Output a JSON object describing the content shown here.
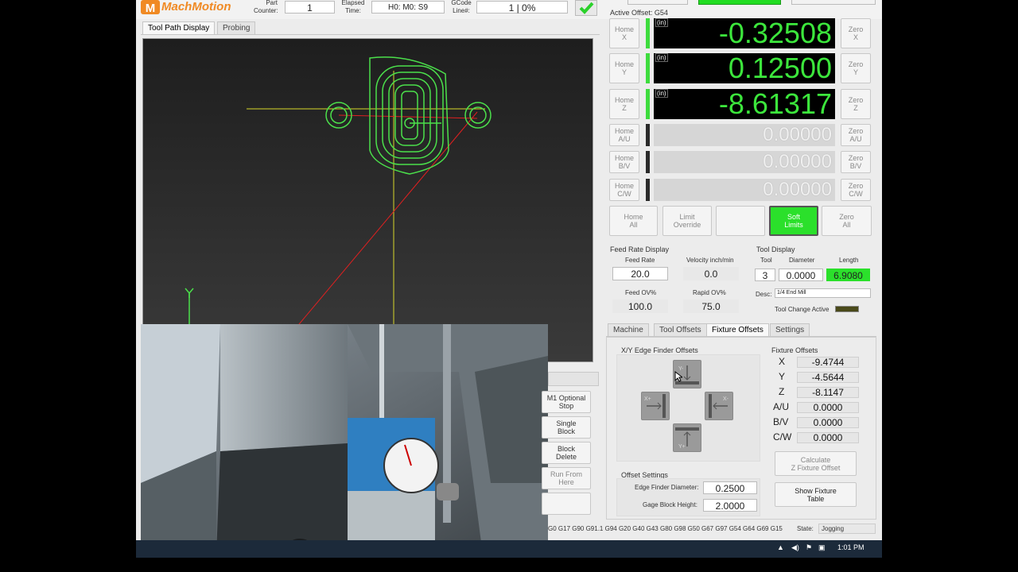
{
  "header": {
    "logo": "MachMotion",
    "part_counter_label": "Part\nCounter:",
    "part_counter": "1",
    "elapsed_label": "Elapsed\nTime:",
    "elapsed": "H0: M0: S9",
    "gcode_label": "GCode\nLine#:",
    "gcode_line": "1 | 0%"
  },
  "tabs_left": [
    {
      "label": "Tool Path Display"
    },
    {
      "label": "Probing"
    }
  ],
  "active_offset": "Active Offset: G54",
  "axes": [
    {
      "home": "Home\nX",
      "zero": "Zero\nX",
      "value": "-0.32508",
      "unit": "(in)",
      "active": true
    },
    {
      "home": "Home\nY",
      "zero": "Zero\nY",
      "value": "0.12500",
      "unit": "(in)",
      "active": true
    },
    {
      "home": "Home\nZ",
      "zero": "Zero\nZ",
      "value": "-8.61317",
      "unit": "(in)",
      "active": true
    },
    {
      "home": "Home\nA/U",
      "zero": "Zero\nA/U",
      "value": "0.00000",
      "unit": "",
      "active": false
    },
    {
      "home": "Home\nB/V",
      "zero": "Zero\nB/V",
      "value": "0.00000",
      "unit": "",
      "active": false
    },
    {
      "home": "Home\nC/W",
      "zero": "Zero\nC/W",
      "value": "0.00000",
      "unit": "",
      "active": false
    }
  ],
  "bottom_buttons": [
    {
      "label": "Home\nAll"
    },
    {
      "label": "Limit\nOverride"
    },
    {
      "label": ""
    },
    {
      "label": "Soft\nLimits"
    },
    {
      "label": "Zero\nAll"
    }
  ],
  "feed": {
    "title": "Feed Rate Display",
    "feed_rate_label": "Feed Rate",
    "feed_rate": "20.0",
    "velocity_label": "Velocity inch/min",
    "velocity": "0.0",
    "feed_ov_label": "Feed OV%",
    "feed_ov": "100.0",
    "rapid_ov_label": "Rapid OV%",
    "rapid_ov": "75.0"
  },
  "tool": {
    "title": "Tool Display",
    "tool_label": "Tool",
    "tool": "3",
    "diameter_label": "Diameter",
    "diameter": "0.0000",
    "length_label": "Length",
    "length": "6.9080",
    "desc_label": "Desc:",
    "desc": "1/4 End Mill",
    "change_label": "Tool Change Active"
  },
  "tabs_right": [
    {
      "label": "Machine"
    },
    {
      "label": "Tool Offsets"
    },
    {
      "label": "Fixture Offsets"
    },
    {
      "label": "Settings"
    }
  ],
  "edge_finder_title": "X/Y Edge Finder Offsets",
  "edge_finder": {
    "y_minus": "Y-",
    "x_plus": "X+",
    "x_minus": "X-",
    "y_plus": "Y+"
  },
  "fixture": {
    "title": "Fixture Offsets",
    "rows": [
      {
        "axis": "X",
        "value": "-9.4744"
      },
      {
        "axis": "Y",
        "value": "-4.5644"
      },
      {
        "axis": "Z",
        "value": "-8.1147"
      },
      {
        "axis": "A/U",
        "value": "0.0000"
      },
      {
        "axis": "B/V",
        "value": "0.0000"
      },
      {
        "axis": "C/W",
        "value": "0.0000"
      }
    ],
    "calc_label": "Calculate\nZ Fixture Offset",
    "show_label": "Show Fixture\nTable"
  },
  "offset_settings": {
    "title": "Offset Settings",
    "diameter_label": "Edge Finder Diameter:",
    "diameter": "0.2500",
    "gage_label": "Gage Block Height:",
    "gage": "2.0000"
  },
  "side_buttons": [
    {
      "label": "M1 Optional\nStop"
    },
    {
      "label": "Single\nBlock"
    },
    {
      "label": "Block\nDelete"
    },
    {
      "label": "Run From\nHere"
    },
    {
      "label": ""
    }
  ],
  "gcodes": "G0 G17 G90 G91.1 G94 G20 G40 G43 G80 G98 G50 G67 G97 G54 G64 G69 G15",
  "state_label": "State:",
  "state": "Jogging",
  "taskbar": {
    "time": "1:01 PM"
  },
  "colors": {
    "dro_green": "#3ce63c",
    "led_on": "#3ddc3d",
    "soft_limits": "#2be02b",
    "toolpath": "#4be04b"
  }
}
